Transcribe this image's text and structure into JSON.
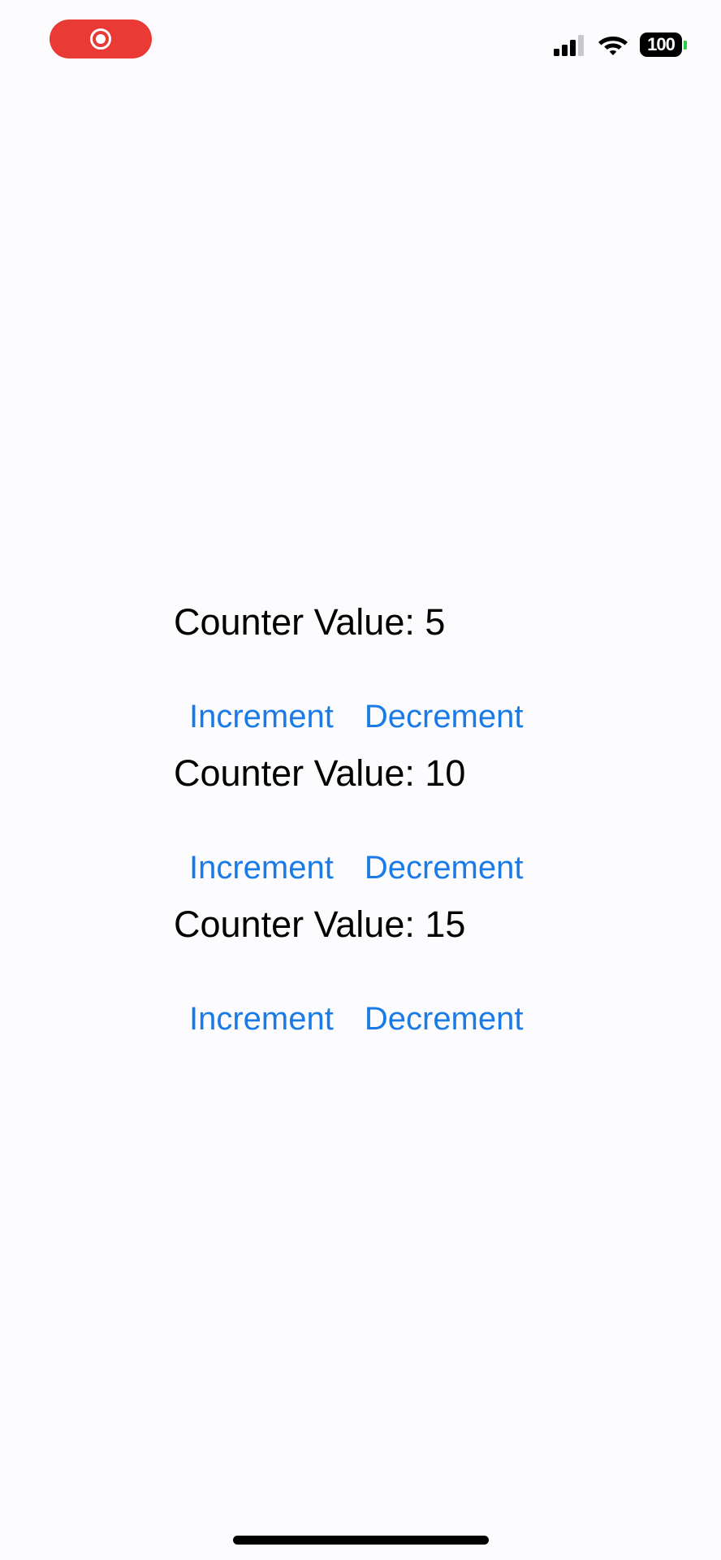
{
  "status_bar": {
    "record_indicator": "record-icon",
    "signal": "cellular-signal-icon",
    "wifi": "wifi-icon",
    "battery_level": "100",
    "battery_tip_color": "#2fc94a",
    "record_color": "#ea3a36"
  },
  "counters": [
    {
      "label": "Counter Value: 5",
      "increment_label": "Increment",
      "decrement_label": "Decrement"
    },
    {
      "label": "Counter Value: 10",
      "increment_label": "Increment",
      "decrement_label": "Decrement"
    },
    {
      "label": "Counter Value: 15",
      "increment_label": "Increment",
      "decrement_label": "Decrement"
    }
  ],
  "colors": {
    "background": "#fcfcfe",
    "button_text": "#1a7ae6",
    "label_text": "#000000"
  }
}
